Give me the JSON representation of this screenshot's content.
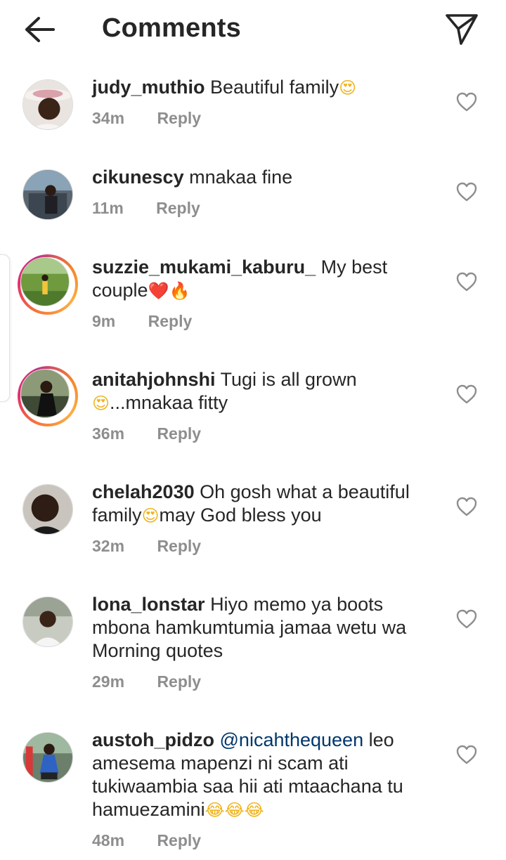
{
  "header": {
    "title": "Comments",
    "back_icon": "arrow-left-icon",
    "send_icon": "paper-plane-icon"
  },
  "comments": [
    {
      "username": "judy_muthio",
      "text": "Beautiful family",
      "emoji_after": "😍",
      "time": "34m",
      "reply_label": "Reply",
      "story_ring": false
    },
    {
      "username": "cikunescy",
      "text": "mnakaa fine",
      "time": "11m",
      "reply_label": "Reply",
      "story_ring": false
    },
    {
      "username": "suzzie_mukami_kaburu_",
      "text_line1": "My best",
      "text_line2": "couple",
      "emojis": "❤️🔥",
      "time": "9m",
      "reply_label": "Reply",
      "story_ring": true
    },
    {
      "username": "anitahjohnshi",
      "text_line1": "Tugi is all grown",
      "emoji_start": "😍",
      "text_line2": "...mnakaa fitty",
      "time": "36m",
      "reply_label": "Reply",
      "story_ring": true
    },
    {
      "username": "chelah2030",
      "text_line1": "Oh gosh what a beautiful",
      "text_line2a": "family",
      "emoji_mid": "😍",
      "text_line2b": "may God bless you",
      "time": "32m",
      "reply_label": "Reply",
      "story_ring": false
    },
    {
      "username": "lona_lonstar",
      "text_line1": "Hiyo memo ya boots",
      "text_line2": "mbona hamkumtumia jamaa wetu wa",
      "text_line3": "Morning quotes",
      "time": "29m",
      "reply_label": "Reply",
      "story_ring": false
    },
    {
      "username": "austoh_pidzo",
      "mention": "@nicahthequeen",
      "text_line1": "leo",
      "text_line2": "amesema mapenzi ni scam ati",
      "text_line3": "tukiwaambia saa hii ati mtaachana tu",
      "text_line4": "hamuezamini",
      "emojis": "😂😂😂",
      "time": "48m",
      "reply_label": "Reply",
      "story_ring": false
    }
  ],
  "icons": {
    "like": "heart-outline-icon"
  },
  "colors": {
    "username": "#262626",
    "meta": "#8e8e8e",
    "mention": "#00376b",
    "story_ring_start": "#f77737",
    "story_ring_end": "#c13584"
  }
}
